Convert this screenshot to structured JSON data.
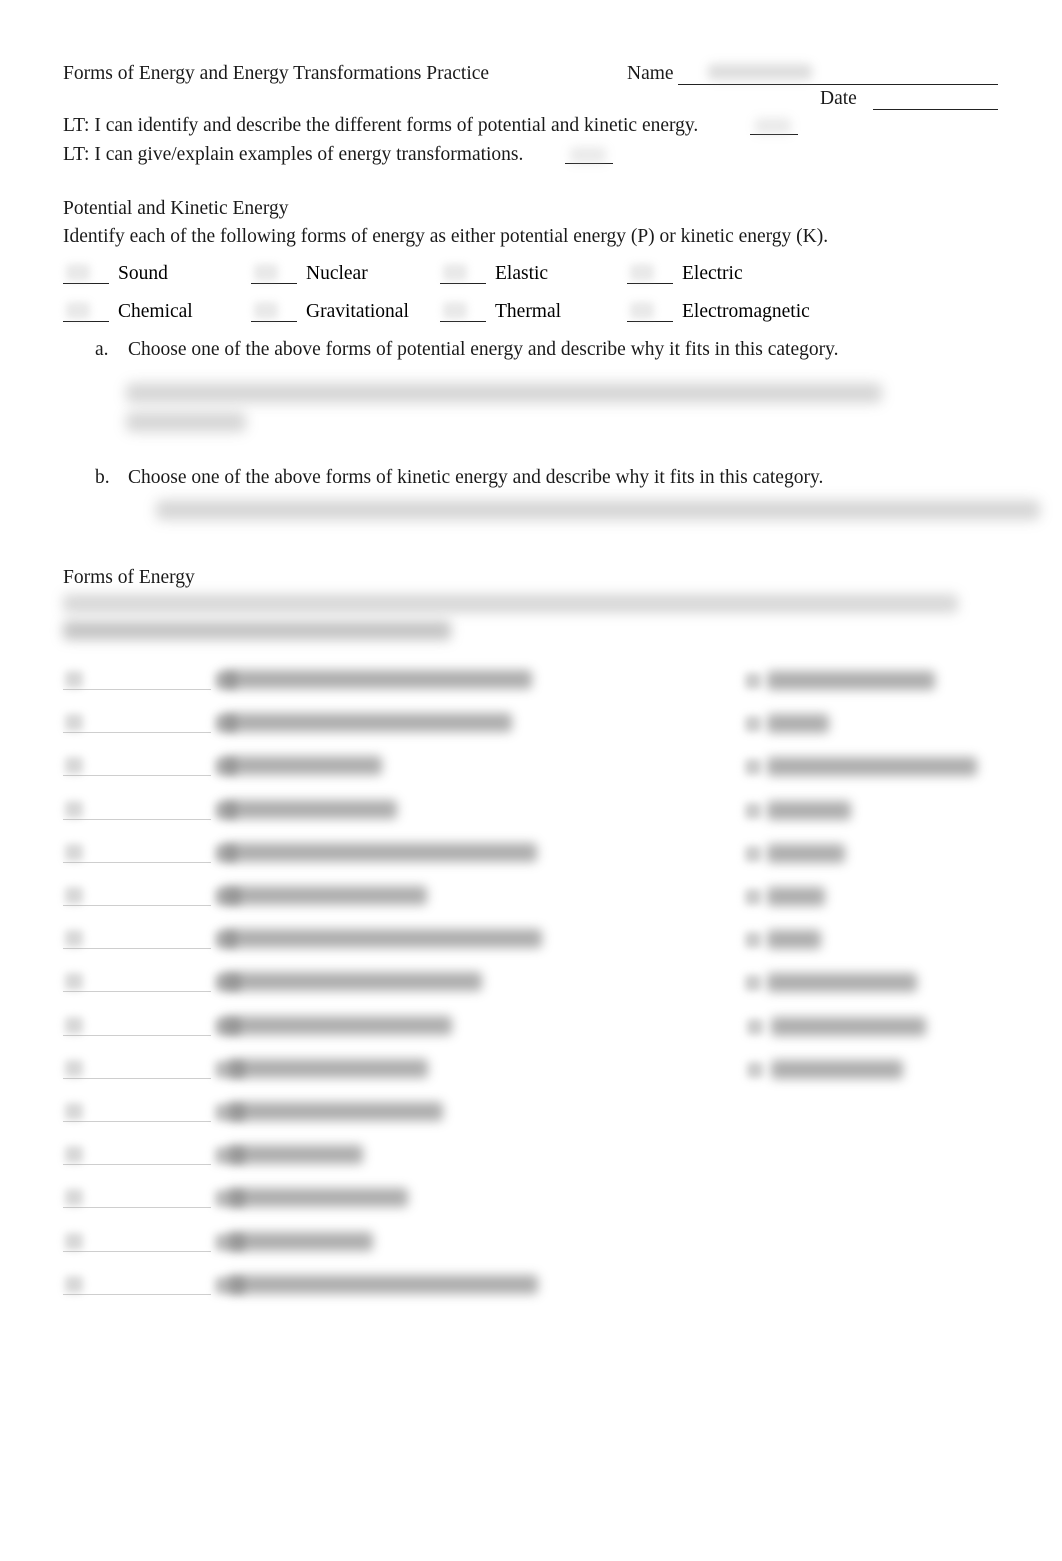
{
  "document": {
    "title": "Forms of Energy and Energy Transformations Practice",
    "name_label": "Name",
    "date_label": "Date",
    "name_value": "",
    "date_value": ""
  },
  "learning_targets": [
    {
      "text": "LT: I can identify and describe the different forms of potential and kinetic energy."
    },
    {
      "text": "LT: I can give/explain examples of energy transformations."
    }
  ],
  "potential_kinetic": {
    "heading": "Potential and Kinetic Energy",
    "instruction": "Identify each of the following forms of energy as either potential energy (P) or kinetic energy (K).",
    "row1": [
      {
        "label": "Sound",
        "answer": ""
      },
      {
        "label": "Nuclear",
        "answer": ""
      },
      {
        "label": "Elastic",
        "answer": ""
      },
      {
        "label": "Electric",
        "answer": ""
      }
    ],
    "row2": [
      {
        "label": "Chemical",
        "answer": ""
      },
      {
        "label": "Gravitational",
        "answer": ""
      },
      {
        "label": "Thermal",
        "answer": ""
      },
      {
        "label": "Electromagnetic",
        "answer": ""
      }
    ],
    "questions": [
      {
        "marker": "a.",
        "prompt": "Choose one of the above forms of potential energy and describe why it fits in this category.",
        "answer_lines": [
          "",
          ""
        ]
      },
      {
        "marker": "b.",
        "prompt": "Choose one of the above forms of kinetic energy and describe why it fits in this category.",
        "answer_lines": [
          ""
        ]
      }
    ]
  },
  "forms_of_energy": {
    "heading": "Forms of Energy",
    "instruction_lines": [
      "",
      ""
    ],
    "items": [
      {
        "number": "1.",
        "text": "",
        "answer": ""
      },
      {
        "number": "2.",
        "text": "",
        "answer": ""
      },
      {
        "number": "3.",
        "text": "",
        "answer": ""
      },
      {
        "number": "4.",
        "text": "",
        "answer": ""
      },
      {
        "number": "5.",
        "text": "",
        "answer": ""
      },
      {
        "number": "6.",
        "text": "",
        "answer": ""
      },
      {
        "number": "7.",
        "text": "",
        "answer": ""
      },
      {
        "number": "8.",
        "text": "",
        "answer": ""
      },
      {
        "number": "9.",
        "text": "",
        "answer": ""
      },
      {
        "number": "10.",
        "text": "",
        "answer": ""
      },
      {
        "number": "11.",
        "text": "",
        "answer": ""
      },
      {
        "number": "12.",
        "text": "",
        "answer": ""
      },
      {
        "number": "13.",
        "text": "",
        "answer": ""
      },
      {
        "number": "14.",
        "text": "",
        "answer": ""
      },
      {
        "number": "15.",
        "text": "",
        "answer": ""
      }
    ],
    "options": [
      {
        "letter": "a.",
        "text": ""
      },
      {
        "letter": "b.",
        "text": ""
      },
      {
        "letter": "c.",
        "text": ""
      },
      {
        "letter": "d.",
        "text": ""
      },
      {
        "letter": "e.",
        "text": ""
      },
      {
        "letter": "f.",
        "text": ""
      },
      {
        "letter": "g.",
        "text": ""
      },
      {
        "letter": "h.",
        "text": ""
      },
      {
        "letter": "i.",
        "text": ""
      },
      {
        "letter": "j.",
        "text": ""
      }
    ]
  },
  "colors": {
    "page_background": "#ffffff",
    "text": "#1a1a1a",
    "rule": "#222222",
    "redaction": "#9d9d9d"
  }
}
